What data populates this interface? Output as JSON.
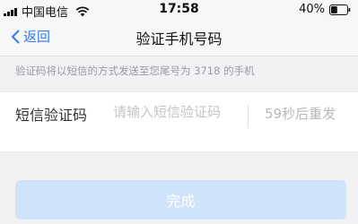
{
  "status_bar": {
    "carrier": "中国电信",
    "time": "17:58",
    "battery_percent": "40%",
    "battery_level": 0.4,
    "icons": [
      "signal-icon",
      "wifi-icon",
      "battery-icon"
    ]
  },
  "nav": {
    "back_label": "返回",
    "title": "验证手机号码"
  },
  "hint": "验证码将以短信的方式发送至您尾号为 3718 的手机",
  "code_row": {
    "label": "短信验证码",
    "input_value": "",
    "placeholder": "请输入短信验证码",
    "resend_label": "59秒后重发"
  },
  "done_button": {
    "label": "完成",
    "enabled": false
  },
  "colors": {
    "accent": "#2f7ef7",
    "button_disabled": "#cfe3fa",
    "background": "#f2f2f4"
  }
}
